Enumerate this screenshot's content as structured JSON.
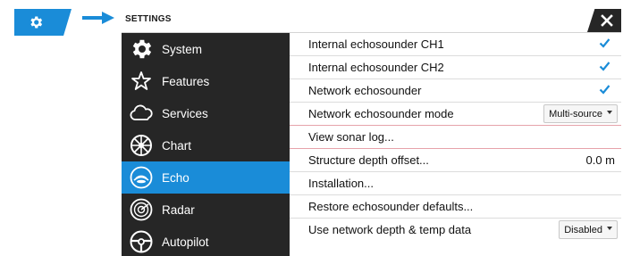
{
  "dialog": {
    "title": "SETTINGS"
  },
  "sidebar": {
    "items": [
      {
        "label": "System",
        "icon": "gear-icon",
        "active": false
      },
      {
        "label": "Features",
        "icon": "star-icon",
        "active": false
      },
      {
        "label": "Services",
        "icon": "cloud-icon",
        "active": false
      },
      {
        "label": "Chart",
        "icon": "chart-wheel-icon",
        "active": false
      },
      {
        "label": "Echo",
        "icon": "echo-icon",
        "active": true
      },
      {
        "label": "Radar",
        "icon": "radar-icon",
        "active": false
      },
      {
        "label": "Autopilot",
        "icon": "steering-wheel-icon",
        "active": false
      }
    ]
  },
  "settings": {
    "rows": [
      {
        "label": "Internal echosounder CH1",
        "type": "checkbox",
        "checked": true
      },
      {
        "label": "Internal echosounder CH2",
        "type": "checkbox",
        "checked": true
      },
      {
        "label": "Network echosounder",
        "type": "checkbox",
        "checked": true
      },
      {
        "label": "Network echosounder mode",
        "type": "dropdown",
        "value": "Multi-source"
      },
      {
        "label": "View sonar log...",
        "type": "action"
      },
      {
        "label": "Structure depth offset...",
        "type": "value",
        "value": "0.0 m"
      },
      {
        "label": "Installation...",
        "type": "action"
      },
      {
        "label": "Restore echosounder defaults...",
        "type": "action"
      },
      {
        "label": "Use network depth & temp data",
        "type": "dropdown",
        "value": "Disabled"
      }
    ]
  },
  "colors": {
    "accent": "#1a8cd8",
    "sidebar_bg": "#262626",
    "check": "#1a8cd8"
  }
}
